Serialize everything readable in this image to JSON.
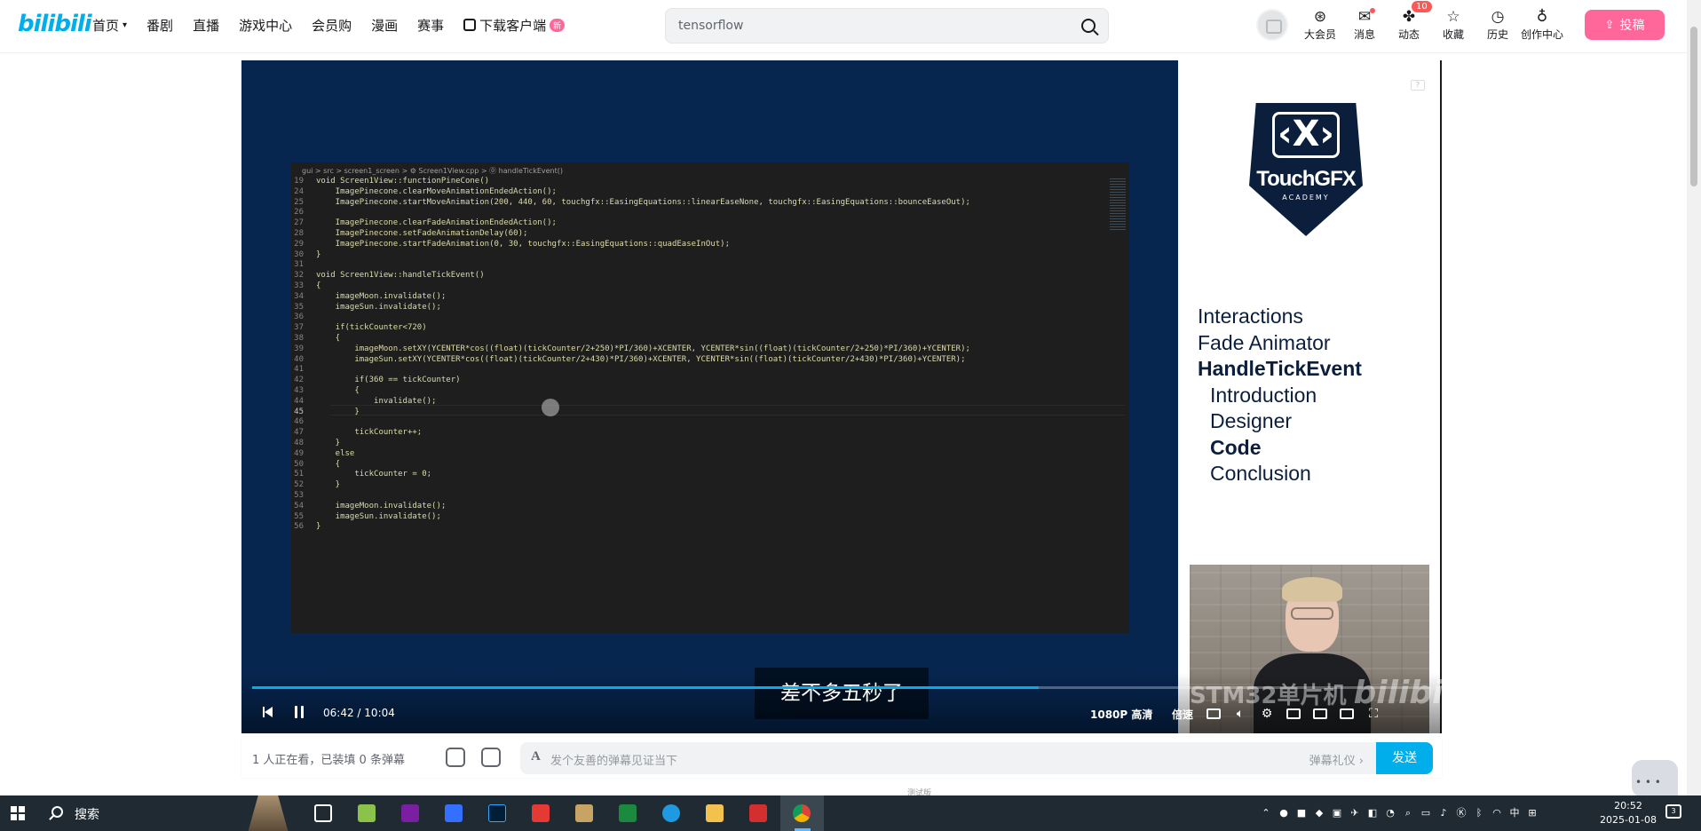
{
  "nav": {
    "logo": "bilibili",
    "links": [
      "首页",
      "番剧",
      "直播",
      "游戏中心",
      "会员购",
      "漫画",
      "赛事"
    ],
    "download_label": "下载客户端",
    "new_badge": "新",
    "search_value": "tensorflow",
    "right_items": [
      {
        "icon": "vip-icon",
        "glyph": "⊛",
        "label": "大会员"
      },
      {
        "icon": "message-icon",
        "glyph": "✉",
        "label": "消息"
      },
      {
        "icon": "dynamic-icon",
        "glyph": "✤",
        "label": "动态",
        "count": "10"
      },
      {
        "icon": "favorites-icon",
        "glyph": "☆",
        "label": "收藏"
      },
      {
        "icon": "history-icon",
        "glyph": "◷",
        "label": "历史"
      },
      {
        "icon": "creator-icon",
        "glyph": "♁",
        "label": "创作中心"
      }
    ],
    "upload_label": "投稿"
  },
  "player": {
    "code": {
      "breadcrumb": "gui > src > screen1_screen > ⚙ Screen1View.cpp > ⓪ handleTickEvent()",
      "lines": [
        {
          "n": "19",
          "t": "void Screen1View::functionPineCone()"
        },
        {
          "n": "24",
          "t": "    ImagePinecone.clearMoveAnimationEndedAction();"
        },
        {
          "n": "25",
          "t": "    ImagePinecone.startMoveAnimation(200, 440, 60, touchgfx::EasingEquations::linearEaseNone, touchgfx::EasingEquations::bounceEaseOut);"
        },
        {
          "n": "26",
          "t": ""
        },
        {
          "n": "27",
          "t": "    ImagePinecone.clearFadeAnimationEndedAction();"
        },
        {
          "n": "28",
          "t": "    ImagePinecone.setFadeAnimationDelay(60);"
        },
        {
          "n": "29",
          "t": "    ImagePinecone.startFadeAnimation(0, 30, touchgfx::EasingEquations::quadEaseInOut);"
        },
        {
          "n": "30",
          "t": "}"
        },
        {
          "n": "31",
          "t": ""
        },
        {
          "n": "32",
          "t": "void Screen1View::handleTickEvent()"
        },
        {
          "n": "33",
          "t": "{"
        },
        {
          "n": "34",
          "t": "    imageMoon.invalidate();"
        },
        {
          "n": "35",
          "t": "    imageSun.invalidate();"
        },
        {
          "n": "36",
          "t": ""
        },
        {
          "n": "37",
          "t": "    if(tickCounter<720)"
        },
        {
          "n": "38",
          "t": "    {"
        },
        {
          "n": "39",
          "t": "        imageMoon.setXY(YCENTER*cos((float)(tickCounter/2+250)*PI/360)+XCENTER, YCENTER*sin((float)(tickCounter/2+250)*PI/360)+YCENTER);"
        },
        {
          "n": "40",
          "t": "        imageSun.setXY(YCENTER*cos((float)(tickCounter/2+430)*PI/360)+XCENTER, YCENTER*sin((float)(tickCounter/2+430)*PI/360)+YCENTER);"
        },
        {
          "n": "41",
          "t": ""
        },
        {
          "n": "42",
          "t": "        if(360 == tickCounter)"
        },
        {
          "n": "43",
          "t": "        {"
        },
        {
          "n": "44",
          "t": "            invalidate();"
        },
        {
          "n": "45",
          "t": "        }"
        },
        {
          "n": "46",
          "t": ""
        },
        {
          "n": "47",
          "t": "        tickCounter++;"
        },
        {
          "n": "48",
          "t": "    }"
        },
        {
          "n": "49",
          "t": "    else"
        },
        {
          "n": "50",
          "t": "    {"
        },
        {
          "n": "51",
          "t": "        tickCounter = 0;"
        },
        {
          "n": "52",
          "t": "    }"
        },
        {
          "n": "53",
          "t": ""
        },
        {
          "n": "54",
          "t": "    imageMoon.invalidate();"
        },
        {
          "n": "55",
          "t": "    imageSun.invalidate();"
        },
        {
          "n": "56",
          "t": "}"
        }
      ]
    },
    "brand": {
      "name": "TouchGFX",
      "sub": "ACADEMY",
      "mark": "‹X›"
    },
    "agenda": [
      {
        "label": "Interactions",
        "sub": false,
        "bold": false
      },
      {
        "label": "Fade Animator",
        "sub": false,
        "bold": false
      },
      {
        "label": "HandleTickEvent",
        "sub": false,
        "bold": true
      },
      {
        "label": "Introduction",
        "sub": true,
        "bold": false
      },
      {
        "label": "Designer",
        "sub": true,
        "bold": false
      },
      {
        "label": "Code",
        "sub": true,
        "bold": true
      },
      {
        "label": "Conclusion",
        "sub": true,
        "bold": false
      }
    ],
    "subtitle": "差不多五秒了",
    "watermark_text": "STM32单片机",
    "watermark_logo": "bilibili",
    "time_current": "06:42",
    "time_separator": "/",
    "time_total": "10:04",
    "progress": 0.667,
    "quality": "1080P 高清",
    "speed": "倍速"
  },
  "below": {
    "viewers": "1 人正在看，已装填 0 条弹幕",
    "danmaku_placeholder": "发个友善的弹幕见证当下",
    "etiquette": "弹幕礼仪 ›",
    "send": "发送",
    "beta": "测试版"
  },
  "taskbar": {
    "search": "搜索",
    "time": "20:52",
    "date": "2025-01-08",
    "ime": "中",
    "notif_count": "3"
  },
  "colors": {
    "accent": "#00aeec",
    "upload_pink": "#ff6699",
    "slide_navy": "#0b1f3d"
  }
}
